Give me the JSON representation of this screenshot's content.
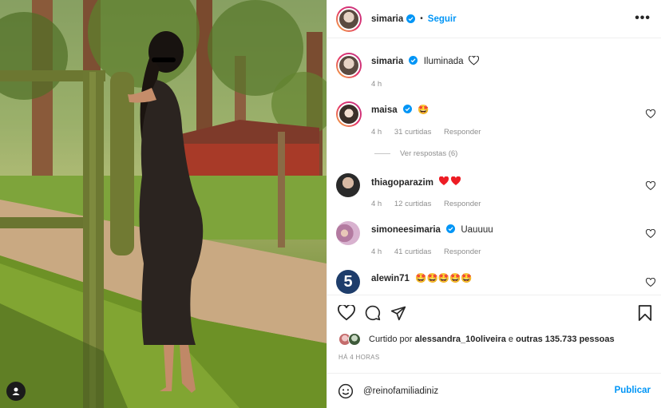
{
  "post": {
    "author": "simaria",
    "follow_label": "Seguir",
    "more_label": "•••",
    "separator": "•"
  },
  "caption": {
    "author": "simaria",
    "text": "Iluminada",
    "time": "4 h"
  },
  "comments": [
    {
      "author": "maisa",
      "text": "🤩",
      "time": "4 h",
      "likes": "31 curtidas",
      "reply": "Responder"
    },
    {
      "author": "thiagoparazim",
      "text": "❤️❤️",
      "time": "4 h",
      "likes": "12 curtidas",
      "reply": "Responder"
    },
    {
      "author": "simoneesimaria",
      "text": "Uauuuu",
      "time": "4 h",
      "likes": "41 curtidas",
      "reply": "Responder"
    },
    {
      "author": "alewin71",
      "text": "🤩🤩🤩🤩🤩",
      "time": "",
      "likes": "",
      "reply": ""
    }
  ],
  "view_replies": "Ver respostas (6)",
  "likes": {
    "prefix": "Curtido por",
    "user": "alessandra_10oliveira",
    "mid": "e",
    "others": "outras 135.733 pessoas"
  },
  "timestamp": "HÁ 4 HORAS",
  "add_comment": {
    "value": "@reinofamiliadiniz",
    "publish_label": "Publicar"
  },
  "colors": {
    "accent": "#0095f6",
    "verified": "#0095f6",
    "heart": "#ed4956",
    "muted": "#8e8e8e"
  },
  "icons": {
    "like": "heart-outline-icon",
    "comment": "speech-bubble-icon",
    "share": "paper-plane-icon",
    "save": "bookmark-icon",
    "emoji": "smiley-icon",
    "tag": "user-tag-icon"
  }
}
